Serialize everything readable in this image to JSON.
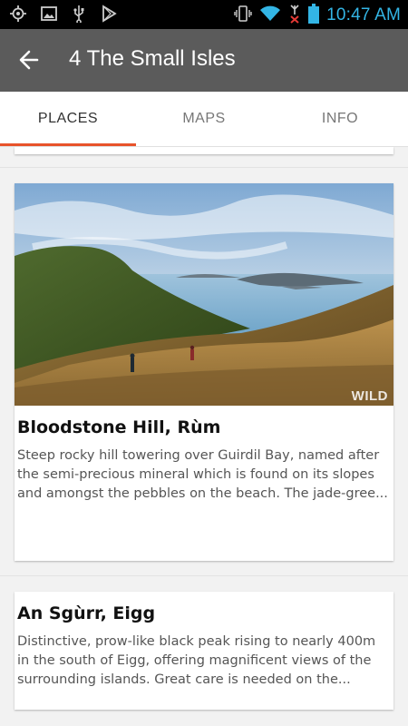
{
  "status_bar": {
    "time": "10:47 AM"
  },
  "app_bar": {
    "title": "4 The Small Isles"
  },
  "tabs": [
    {
      "label": "PLACES",
      "active": true
    },
    {
      "label": "MAPS",
      "active": false
    },
    {
      "label": "INFO",
      "active": false
    }
  ],
  "places": [
    {
      "title": "Bloodstone Hill, Rùm",
      "description": "Steep rocky hill towering over Guirdil Bay, named after the semi-precious mineral which is found on its slopes and amongst the pebbles on the beach. The jade-gree...",
      "image_watermark": "WILD"
    },
    {
      "title": "An Sgùrr, Eigg",
      "description": "Distinctive, prow-like black peak rising to nearly 400m in the south of Eigg, offering magnificent views of the surrounding islands. Great care is needed on the..."
    }
  ],
  "colors": {
    "app_bar": "#5b5b5b",
    "accent": "#e8532b",
    "status_time": "#33b5e5"
  }
}
